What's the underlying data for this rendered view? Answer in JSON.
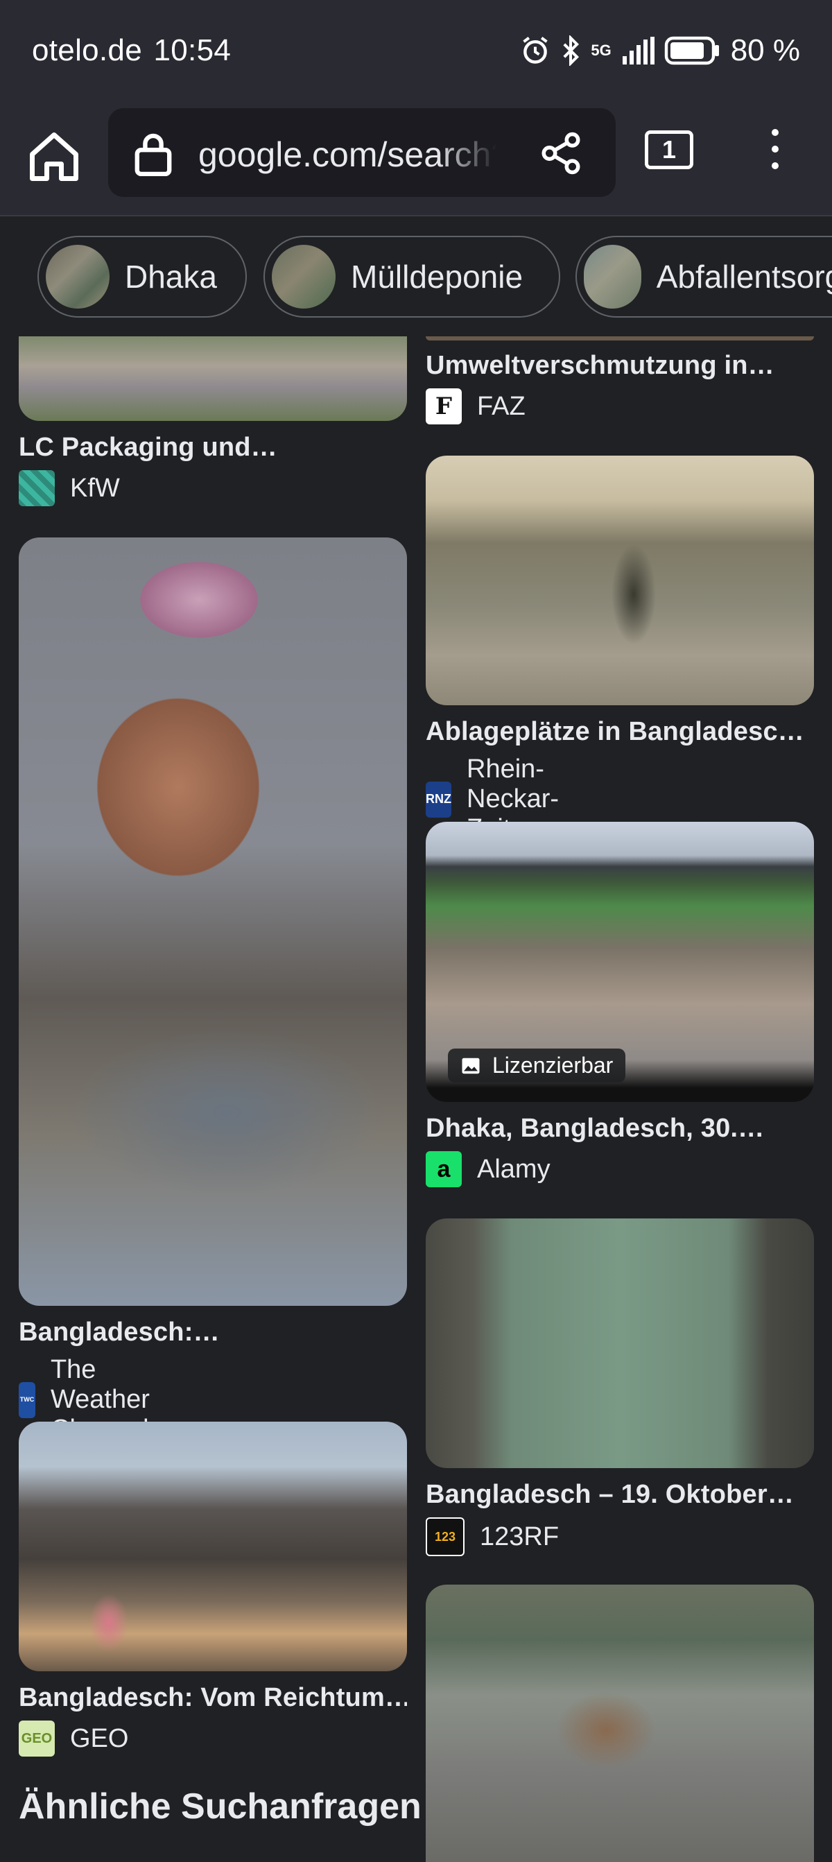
{
  "status_bar": {
    "carrier": "otelo.de",
    "time": "10:54",
    "network": "5G",
    "battery": "80 %"
  },
  "toolbar": {
    "url": "google.com/search?",
    "tab_count": "1"
  },
  "chips": [
    {
      "label": "Dhaka"
    },
    {
      "label": "Mülldeponie"
    },
    {
      "label": "Abfallentsorgung"
    }
  ],
  "results": {
    "left": [
      {
        "caption": "LC Packaging und…",
        "source": "KfW"
      },
      {
        "caption": "Bangladesch:…",
        "source": "The Weather Channel"
      },
      {
        "caption": "Bangladesch: Vom Reichtum…",
        "source": "GEO"
      }
    ],
    "right": [
      {
        "caption": "Umweltverschmutzung in…",
        "source": "FAZ"
      },
      {
        "caption": "Ablageplätze in Bangladesc…",
        "source": "Rhein-Neckar-Zeitung"
      },
      {
        "caption": "Dhaka, Bangladesch, 30.…",
        "source": "Alamy",
        "badge": "Lizenzierbar"
      },
      {
        "caption": "Bangladesch – 19. Oktober…",
        "source": "123RF"
      }
    ]
  },
  "favicons": {
    "faz": "F",
    "rnz": "RNZ",
    "alamy": "a",
    "123rf": "123",
    "geo": "GEO",
    "weather": "The Weather Channel"
  },
  "related_heading": "Ähnliche Suchanfragen",
  "colors": {
    "background": "#202124",
    "bar": "#2a2a33",
    "text": "#e8eaed"
  }
}
